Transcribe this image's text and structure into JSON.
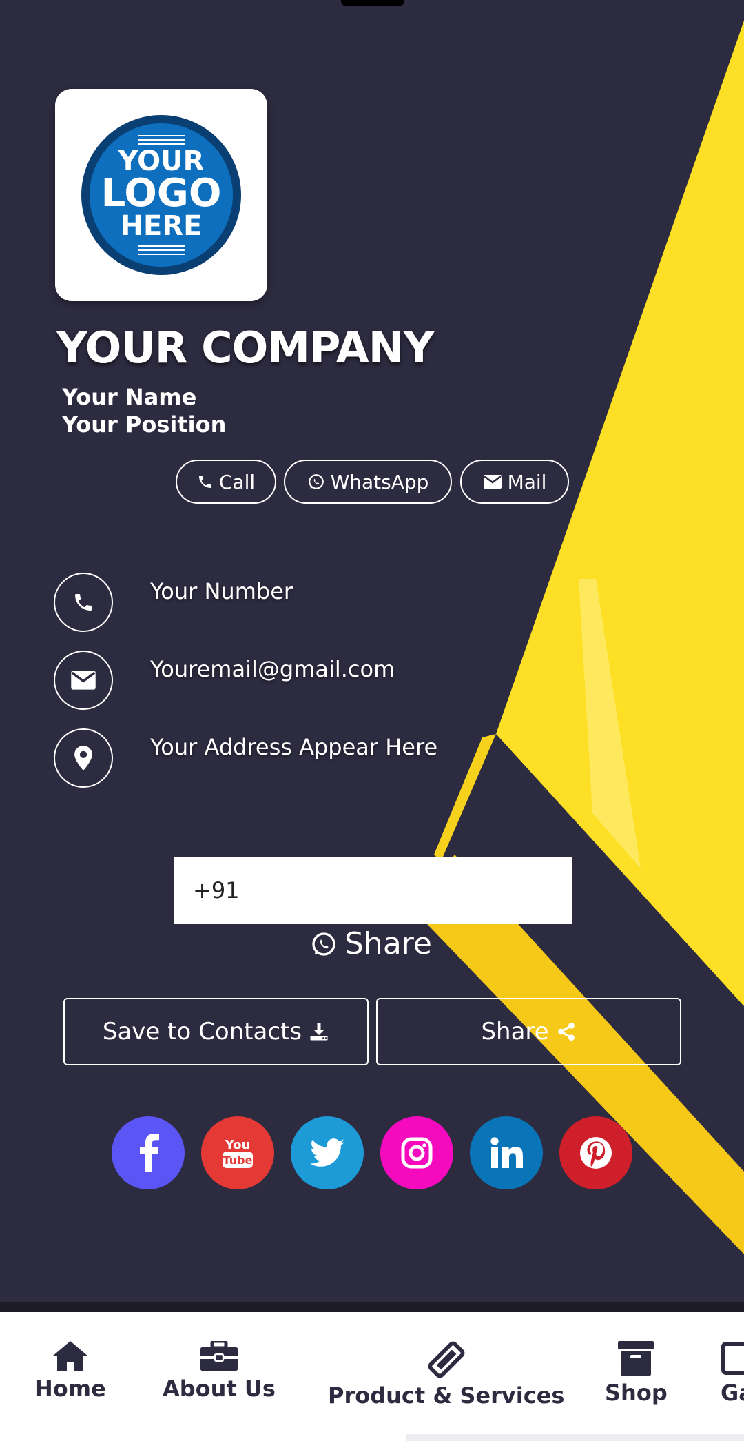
{
  "company": {
    "name": "YOUR COMPANY",
    "person_name": "Your Name",
    "position": "Your Position",
    "logo_text": [
      "YOUR",
      "LOGO",
      "HERE"
    ]
  },
  "actions": {
    "call": "Call",
    "whatsapp": "WhatsApp",
    "mail": "Mail"
  },
  "contact": {
    "phone": "Your Number",
    "email": "Youremail@gmail.com",
    "address": "Your Address Appear Here"
  },
  "whatsapp_share": {
    "input_value": "+91",
    "label": "Share"
  },
  "buttons": {
    "save_contacts": "Save to Contacts",
    "share": "Share"
  },
  "social": [
    {
      "name": "facebook-icon",
      "color": "#5b55f5"
    },
    {
      "name": "youtube-icon",
      "color": "#e53935"
    },
    {
      "name": "twitter-icon",
      "color": "#1d9bd7"
    },
    {
      "name": "instagram-icon",
      "color": "#f50bbd"
    },
    {
      "name": "linkedin-icon",
      "color": "#0a74b9"
    },
    {
      "name": "pinterest-icon",
      "color": "#cf1f2b"
    }
  ],
  "nav": {
    "items": [
      {
        "label": "Home",
        "icon": "home-icon"
      },
      {
        "label": "About Us",
        "icon": "briefcase-icon"
      },
      {
        "label": "Product & Services",
        "icon": "ticket-icon"
      },
      {
        "label": "Shop",
        "icon": "archive-box-icon"
      },
      {
        "label": "Ga",
        "icon": "gallery-icon"
      }
    ]
  },
  "colors": {
    "background": "#2d2b3f",
    "accent_yellow": "#fde025",
    "nav_background": "#ffffff"
  }
}
